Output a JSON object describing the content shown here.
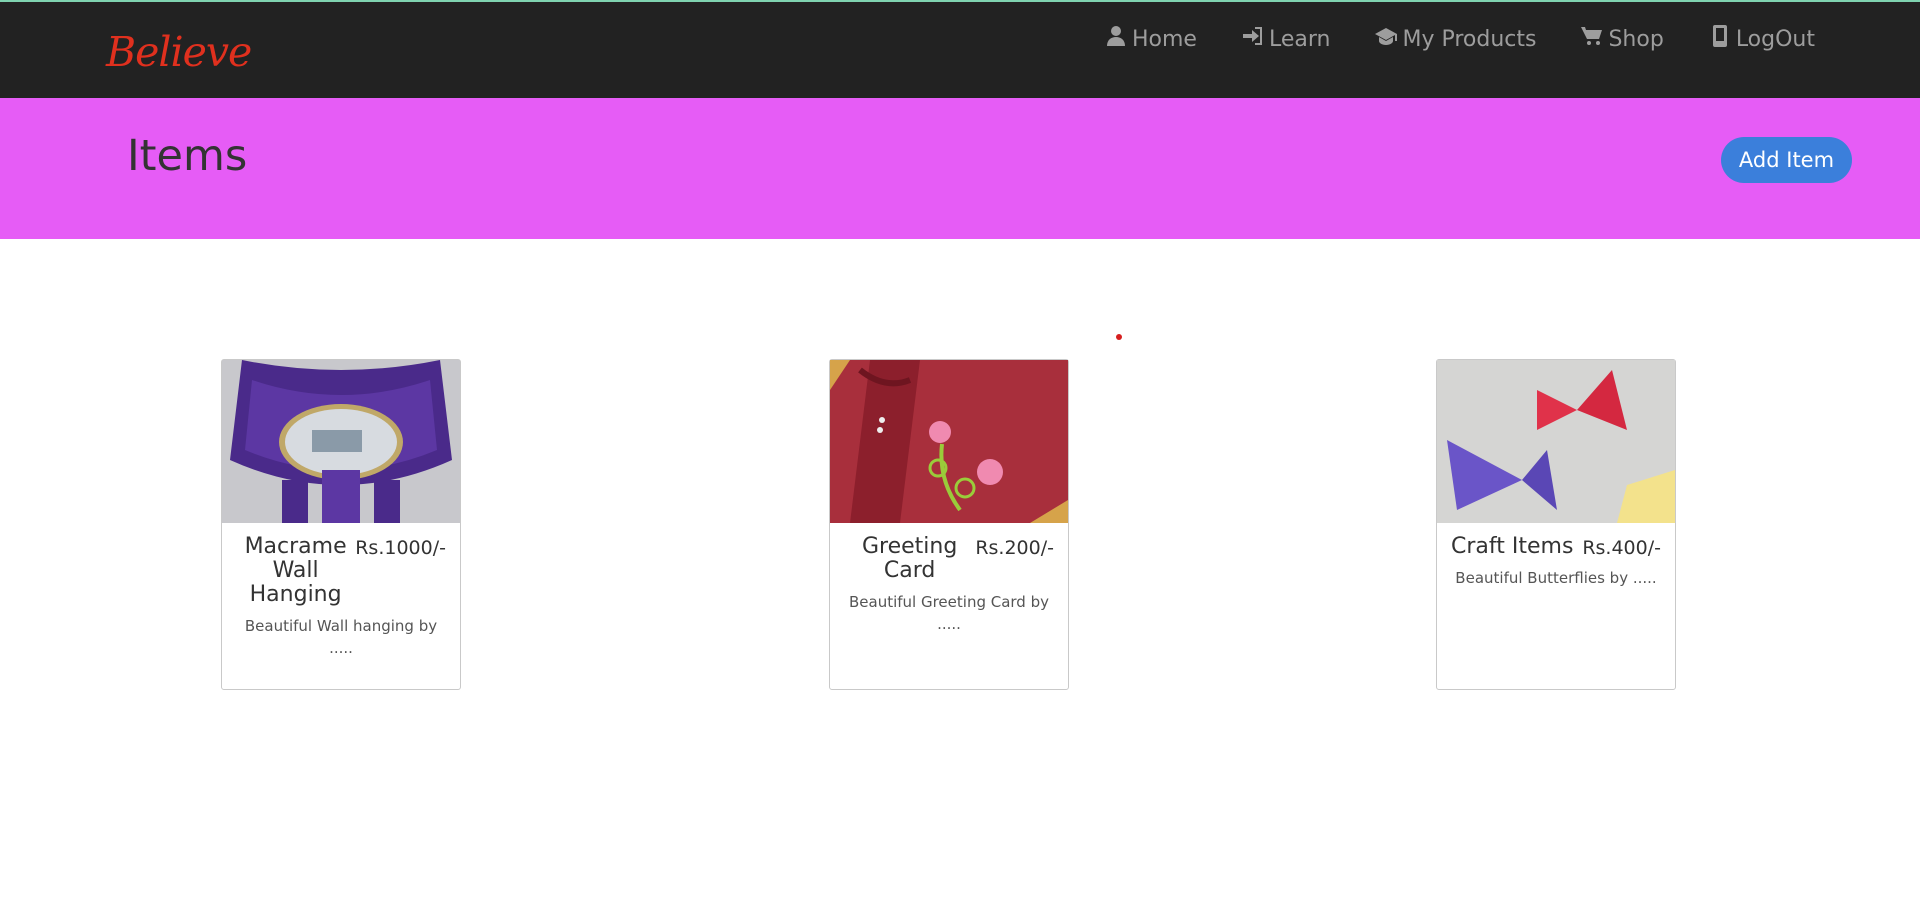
{
  "brand": "Believe",
  "nav": [
    {
      "label": "Home",
      "icon": "user-icon"
    },
    {
      "label": "Learn",
      "icon": "login-icon"
    },
    {
      "label": "My Products",
      "icon": "graduation-cap-icon"
    },
    {
      "label": "Shop",
      "icon": "cart-icon"
    },
    {
      "label": "LogOut",
      "icon": "phone-icon"
    }
  ],
  "banner": {
    "title": "Items",
    "add_button": "Add Item",
    "color": "#e65cf6"
  },
  "products": [
    {
      "name": "Macrame Wall Hanging",
      "price": "Rs.1000/-",
      "description": "Beautiful Wall hanging by .....",
      "image": "macrame-wall-hanging-image"
    },
    {
      "name": "Greeting Card",
      "price": "Rs.200/-",
      "description": "Beautiful Greeting Card by .....",
      "image": "greeting-card-image"
    },
    {
      "name": "Craft Items",
      "price": "Rs.400/-",
      "description": "Beautiful Butterflies by .....",
      "image": "paper-butterflies-image"
    }
  ],
  "colors": {
    "navbar": "#222222",
    "brand": "#e0301e",
    "button": "#3b7fdb"
  }
}
